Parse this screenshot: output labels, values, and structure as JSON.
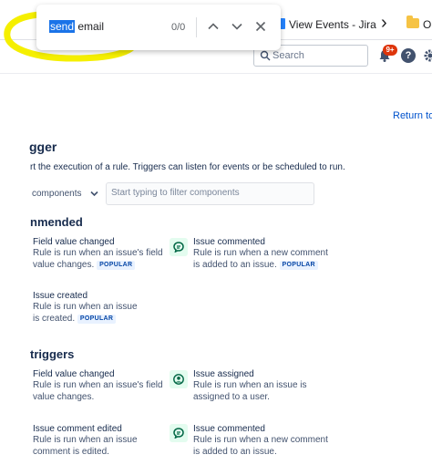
{
  "browser": {
    "find": {
      "query_highlighted": "send",
      "query_rest": " email",
      "count": "0/0"
    },
    "bookmarks": [
      {
        "label": "View Events - Jira"
      },
      {
        "label": "O"
      }
    ]
  },
  "topbar": {
    "search_placeholder": "Search",
    "notifications_badge": "9+",
    "help_label": "?"
  },
  "page": {
    "return_link": "Return to",
    "heading": "gger",
    "intro": "rt the execution of a rule. Triggers can listen for events or be scheduled to run.",
    "filter": {
      "components_selected": "components",
      "search_placeholder": "Start typing to filter components"
    },
    "sections": [
      {
        "title": "nmended",
        "cards": [
          {
            "title": "Field value changed",
            "desc": "Rule is run when an issue's field value changes.",
            "badge": "POPULAR",
            "icon": ""
          },
          {
            "title": "Issue commented",
            "desc": "Rule is run when a new comment is added to an issue.",
            "badge": "POPULAR",
            "icon": "comment-icon"
          },
          {
            "title": "Issue created",
            "desc": "Rule is run when an issue is created.",
            "badge": "POPULAR",
            "icon": ""
          }
        ]
      },
      {
        "title": "triggers",
        "cards": [
          {
            "title": "Field value changed",
            "desc": "Rule is run when an issue's field value changes.",
            "badge": "",
            "icon": ""
          },
          {
            "title": "Issue assigned",
            "desc": "Rule is run when an issue is assigned to a user.",
            "badge": "",
            "icon": "user-icon"
          },
          {
            "title": "Issue comment edited",
            "desc": "Rule is run when an issue comment is edited.",
            "badge": "",
            "icon": ""
          },
          {
            "title": "Issue commented",
            "desc": "Rule is run when a new comment is added to an issue.",
            "badge": "",
            "icon": "comment-icon"
          }
        ]
      }
    ]
  },
  "colors": {
    "accent": "#0052cc",
    "badge_bg": "#e9f2ff",
    "icon_bg": "#e3fcef",
    "icon_fg": "#006644",
    "scribble": "#f5ef00"
  }
}
